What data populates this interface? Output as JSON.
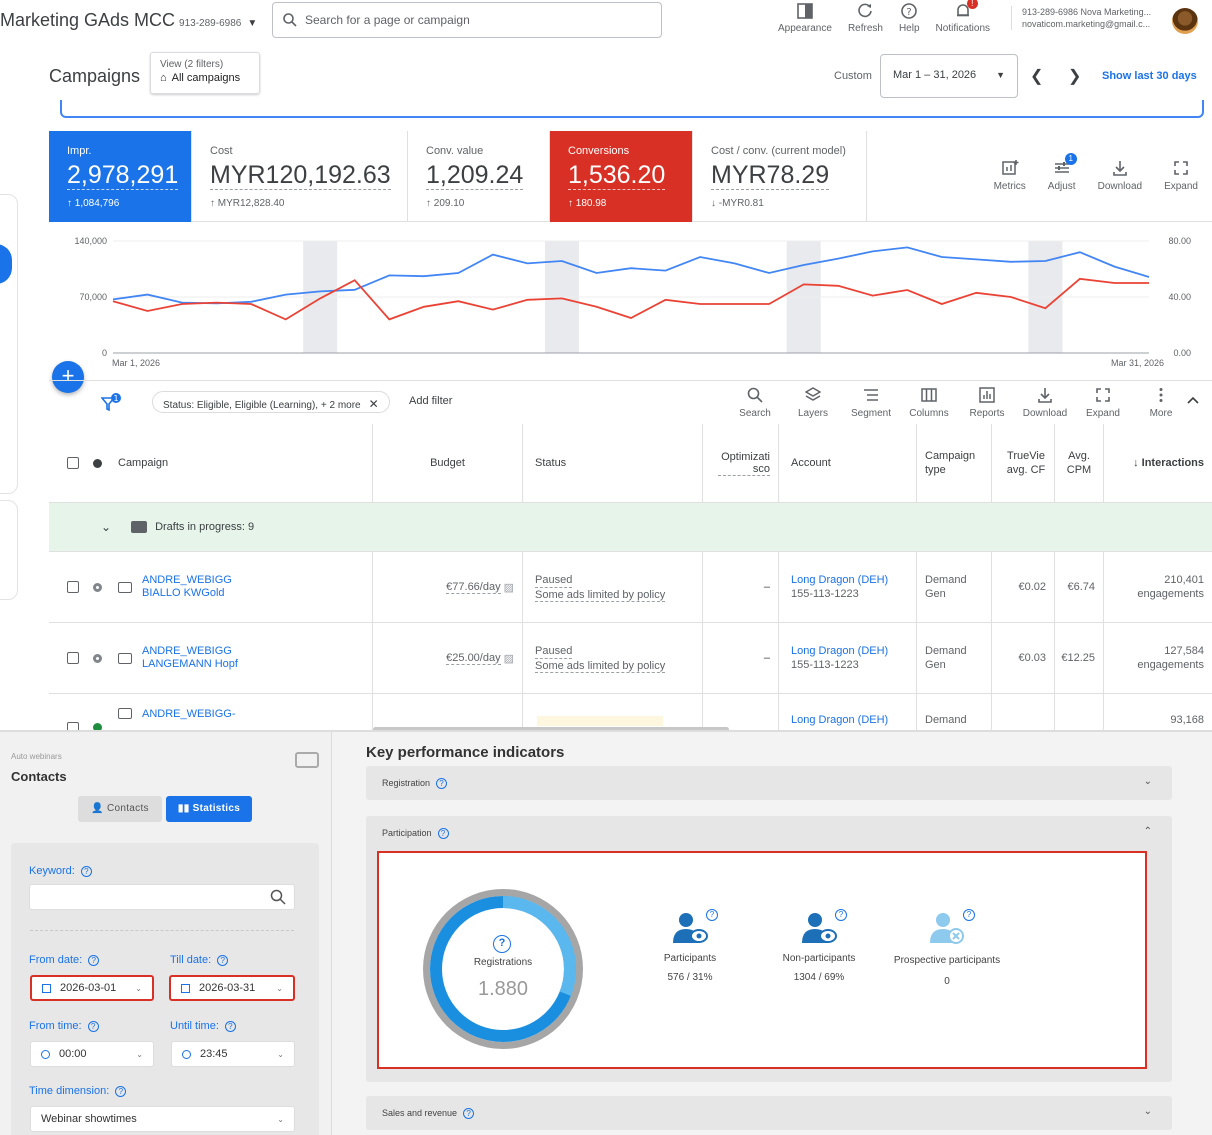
{
  "header": {
    "app_title": "Marketing GAds MCC",
    "account_id": "913-289-6986",
    "search_placeholder": "Search for a page or campaign",
    "tools": [
      {
        "label": "Appearance",
        "icon": "appearance-icon"
      },
      {
        "label": "Refresh",
        "icon": "refresh-icon"
      },
      {
        "label": "Help",
        "icon": "help-icon"
      },
      {
        "label": "Notifications",
        "icon": "bell-icon"
      }
    ],
    "user_line1": "913-289-6986 Nova Marketing...",
    "user_line2": "novaticom.marketing@gmail.c..."
  },
  "page": {
    "title": "Campaigns",
    "view_label": "View (2 filters)",
    "view_value": "All campaigns",
    "date_mode": "Custom",
    "date_range": "Mar 1 – 31, 2026",
    "show_last": "Show last 30 days"
  },
  "metrics": [
    {
      "label": "Impr.",
      "value": "2,978,291",
      "delta": "↑ 1,084,796",
      "style": "blue"
    },
    {
      "label": "Cost",
      "value": "MYR120,192.63",
      "delta": "↑ MYR12,828.40",
      "style": "plain"
    },
    {
      "label": "Conv. value",
      "value": "1,209.24",
      "delta": "↑ 209.10",
      "style": "plain"
    },
    {
      "label": "Conversions",
      "value": "1,536.20",
      "delta": "↑ 180.98",
      "style": "red"
    },
    {
      "label": "Cost / conv. (current model)",
      "value": "MYR78.29",
      "delta": "↓ -MYR0.81",
      "style": "plain"
    }
  ],
  "metric_tools": [
    {
      "label": "Metrics",
      "icon": "metrics-icon"
    },
    {
      "label": "Adjust",
      "icon": "adjust-icon",
      "badge": "1"
    },
    {
      "label": "Download",
      "icon": "download-icon"
    },
    {
      "label": "Expand",
      "icon": "expand-icon"
    }
  ],
  "chart_data": {
    "type": "line",
    "x_start_label": "Mar 1, 2026",
    "x_end_label": "Mar 31, 2026",
    "y_left_ticks": [
      "0",
      "70,000",
      "140,000"
    ],
    "y_right_ticks": [
      "0.00",
      "40.00",
      "80.00"
    ],
    "ylim_left": [
      0,
      140000
    ],
    "ylim_right": [
      0,
      80
    ],
    "series": [
      {
        "axis": "left",
        "color": "#4285f4",
        "values": [
          67000,
          73000,
          63000,
          62000,
          64000,
          73000,
          77000,
          79000,
          97000,
          96000,
          100000,
          123000,
          112000,
          115000,
          100000,
          106000,
          103000,
          120000,
          112000,
          100000,
          110000,
          118000,
          127000,
          132000,
          120000,
          117000,
          114000,
          115000,
          126000,
          108000,
          95000
        ]
      },
      {
        "axis": "right",
        "color": "#ea4335",
        "values": [
          37,
          30,
          35,
          36,
          35,
          24,
          39,
          52,
          24,
          33,
          37,
          31,
          38,
          39,
          33,
          25,
          38,
          35,
          35,
          35,
          49,
          48,
          41,
          45,
          35,
          43,
          40,
          32,
          53,
          50,
          50
        ]
      }
    ]
  },
  "filters": {
    "chip": "Status: Eligible, Eligible (Learning), + 2 more",
    "add_filter": "Add filter",
    "badge": "1"
  },
  "table_tools": [
    {
      "label": "Search",
      "icon": "search-icon"
    },
    {
      "label": "Layers",
      "icon": "layers-icon"
    },
    {
      "label": "Segment",
      "icon": "segment-icon"
    },
    {
      "label": "Columns",
      "icon": "columns-icon"
    },
    {
      "label": "Reports",
      "icon": "reports-icon"
    },
    {
      "label": "Download",
      "icon": "download-icon"
    },
    {
      "label": "Expand",
      "icon": "expand-icon"
    },
    {
      "label": "More",
      "icon": "more-icon"
    }
  ],
  "table": {
    "headers": [
      "Campaign",
      "Budget",
      "Status",
      "Optimizati sco",
      "Account",
      "Campaign type",
      "TrueVie avg. CF",
      "Avg. CPM",
      "↓ Interactions"
    ],
    "drafts": "Drafts in progress: 9",
    "rows": [
      {
        "name1": "ANDRE_WEBIGG",
        "name2": "BIALLO KWGold",
        "budget": "€77.66/day",
        "status1": "Paused",
        "status2": "Some ads limited by policy",
        "opt": "–",
        "account1": "Long Dragon (DEH)",
        "account2": "155-113-1223",
        "type1": "Demand",
        "type2": "Gen",
        "cpv": "€0.02",
        "cpm": "€6.74",
        "inter1": "210,401",
        "inter2": "engagements",
        "dot": "pause"
      },
      {
        "name1": "ANDRE_WEBIGG",
        "name2": "LANGEMANN Hopf",
        "budget": "€25.00/day",
        "status1": "Paused",
        "status2": "Some ads limited by policy",
        "opt": "–",
        "account1": "Long Dragon (DEH)",
        "account2": "155-113-1223",
        "type1": "Demand",
        "type2": "Gen",
        "cpv": "€0.03",
        "cpm": "€12.25",
        "inter1": "127,584",
        "inter2": "engagements",
        "dot": "pause"
      },
      {
        "name1": "ANDRE_WEBIGG-",
        "name2": "",
        "budget": "",
        "status1": "",
        "status2": "",
        "opt": "",
        "account1": "Long Dragon (DEH)",
        "account2": "",
        "type1": "Demand",
        "type2": "",
        "cpv": "",
        "cpm": "",
        "inter1": "93,168",
        "inter2": "",
        "dot": "green"
      }
    ]
  },
  "webinar": {
    "breadcrumb": "Auto webinars",
    "title": "Contacts",
    "tab_contacts": "Contacts",
    "tab_statistics": "Statistics",
    "keyword_label": "Keyword:",
    "from_date_label": "From date:",
    "from_date": "2026-03-01",
    "till_date_label": "Till date:",
    "till_date": "2026-03-31",
    "from_time_label": "From time:",
    "from_time": "00:00",
    "until_time_label": "Until time:",
    "until_time": "23:45",
    "time_dim_label": "Time dimension:",
    "time_dim": "Webinar showtimes"
  },
  "kpi": {
    "title": "Key performance indicators",
    "sections": [
      "Registration",
      "Participation",
      "Sales and revenue"
    ],
    "registrations_label": "Registrations",
    "registrations_value": "1.880",
    "participant_share": 0.31,
    "participants_label": "Participants",
    "participants_value": "576 / 31%",
    "non_participants_label": "Non-participants",
    "non_participants_value": "1304 / 69%",
    "prospective_label": "Prospective participants",
    "prospective_value": "0"
  }
}
